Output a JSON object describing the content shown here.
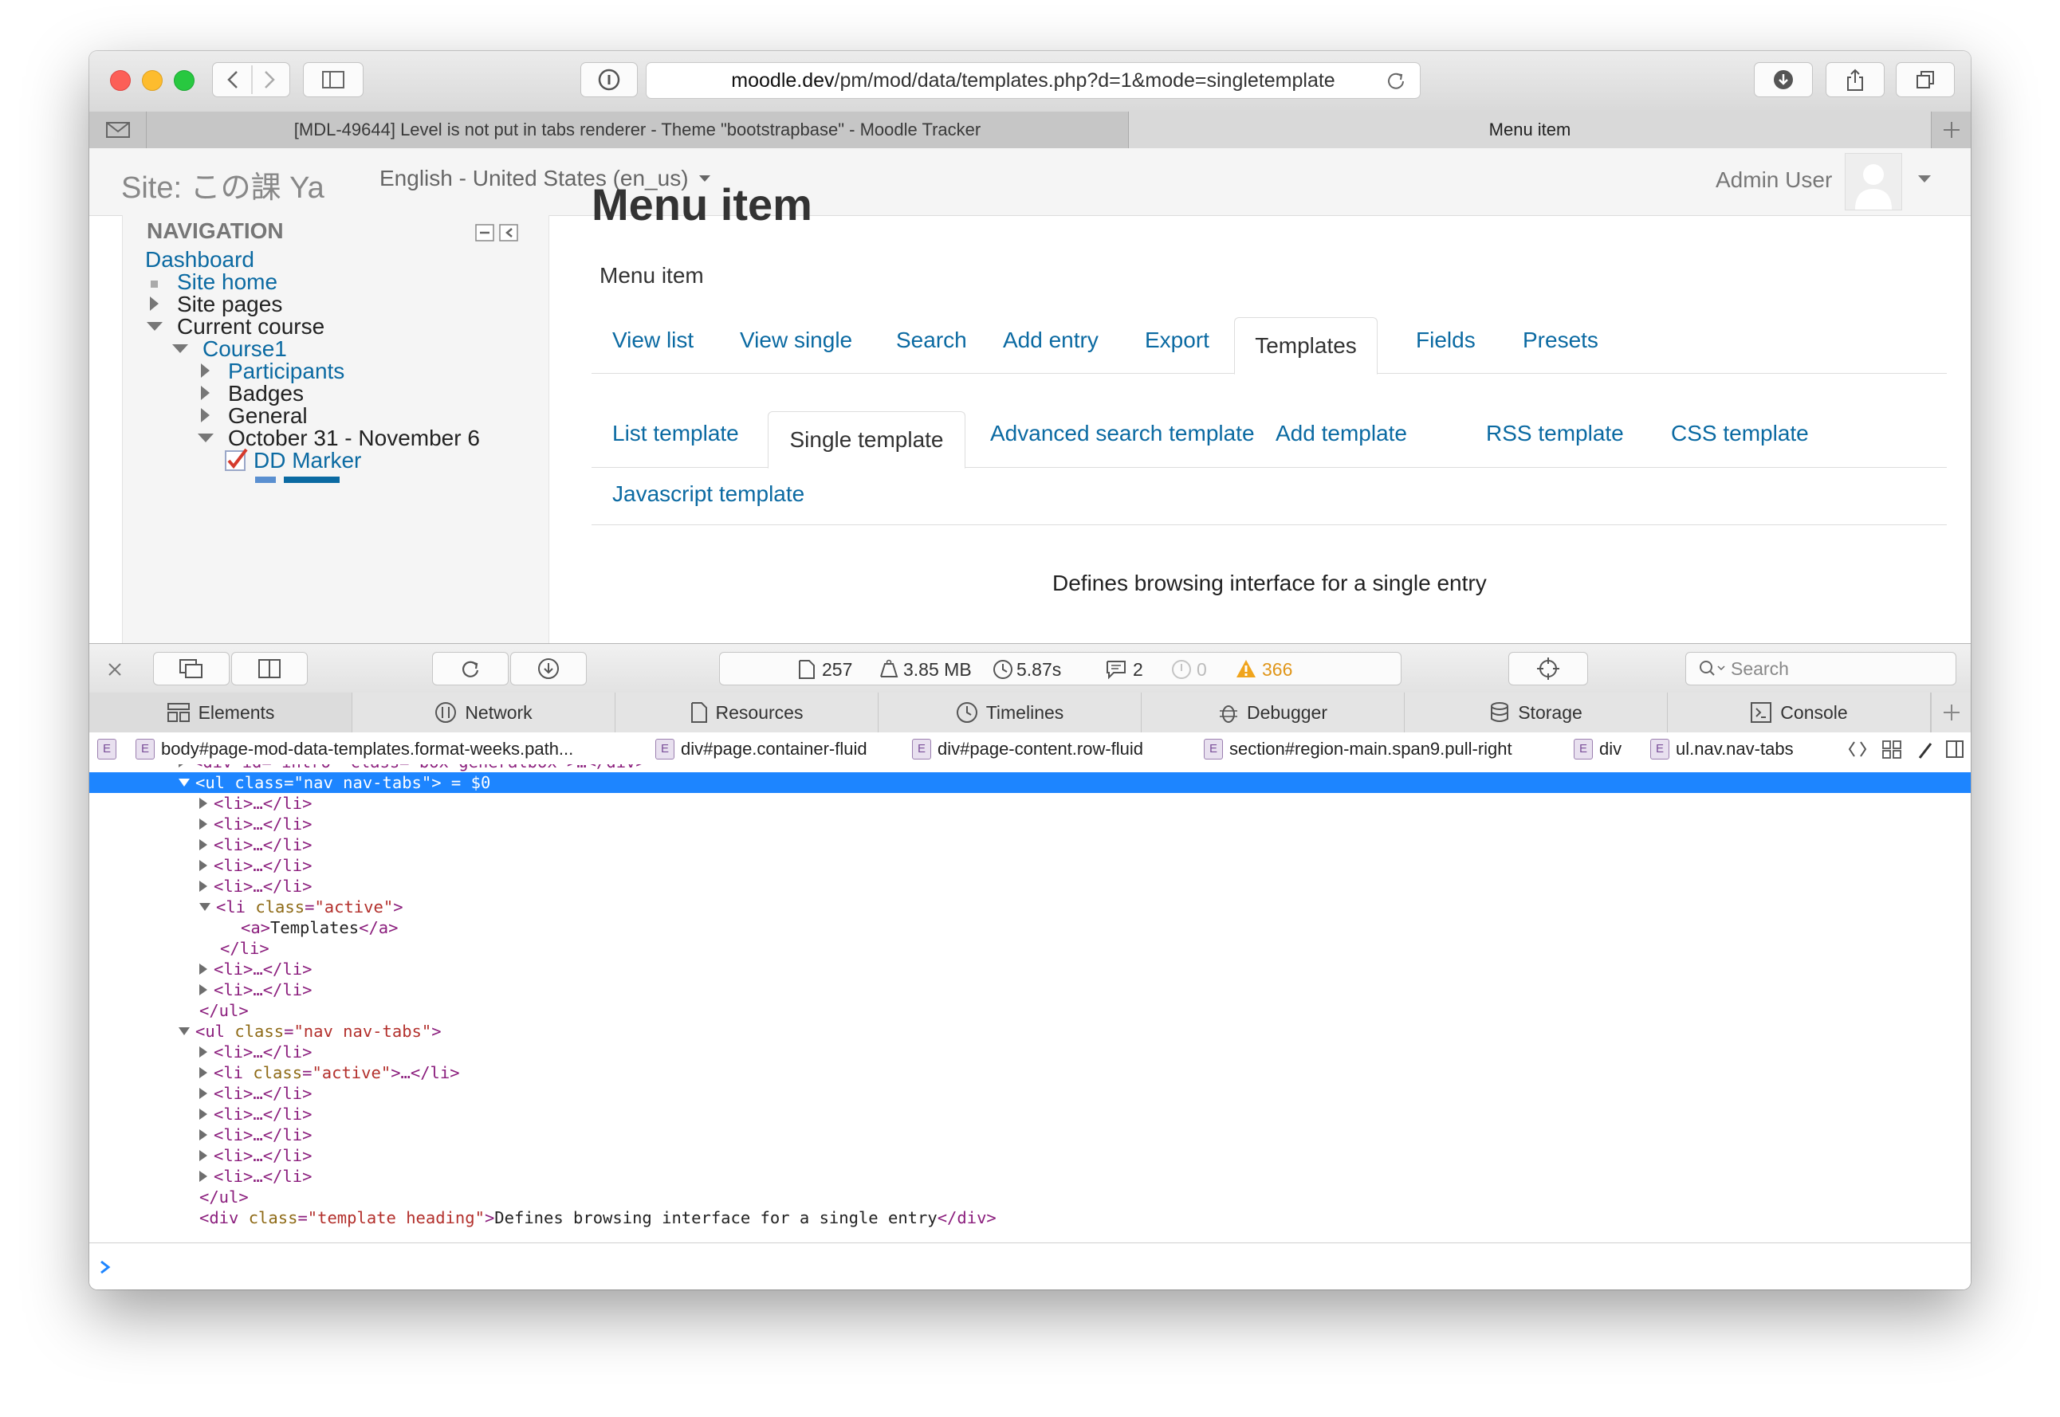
{
  "browser": {
    "url_host": "moodle.dev",
    "url_path": "/pm/mod/data/templates.php?d=1&mode=singletemplate",
    "tabs": [
      {
        "label": "[MDL-49644] Level is not put in tabs renderer - Theme \"bootstrapbase\" - Moodle Tracker"
      },
      {
        "label": "Menu item"
      }
    ]
  },
  "site": {
    "name": "Site: この課 Ya",
    "language": "English - United States (en_us)",
    "user": "Admin User"
  },
  "navigation": {
    "title": "NAVIGATION",
    "items": [
      {
        "label": "Dashboard"
      },
      {
        "label": "Site home"
      },
      {
        "label": "Site pages"
      },
      {
        "label": "Current course"
      },
      {
        "label": "Course1"
      },
      {
        "label": "Participants"
      },
      {
        "label": "Badges"
      },
      {
        "label": "General"
      },
      {
        "label": "October 31 - November 6"
      },
      {
        "label": "DD Marker"
      }
    ]
  },
  "main": {
    "heading": "Menu item",
    "intro": "Menu item",
    "tabs": [
      "View list",
      "View single",
      "Search",
      "Add entry",
      "Export",
      "Templates",
      "Fields",
      "Presets"
    ],
    "subtabs": [
      "List template",
      "Single template",
      "Advanced search template",
      "Add template",
      "RSS template",
      "CSS template",
      "Javascript template"
    ],
    "template_heading": "Defines browsing interface for a single entry"
  },
  "devtools": {
    "stats": {
      "resources": "257",
      "size": "3.85 MB",
      "time": "5.87s",
      "logs": "2",
      "errors": "0",
      "warnings": "366"
    },
    "search_placeholder": "Search",
    "tabs": [
      "Elements",
      "Network",
      "Resources",
      "Timelines",
      "Debugger",
      "Storage",
      "Console"
    ],
    "breadcrumbs": [
      "body#page-mod-data-templates.format-weeks.path...",
      "div#page.container-fluid",
      "div#page-content.row-fluid",
      "section#region-main.span9.pull-right",
      "div",
      "ul.nav.nav-tabs"
    ],
    "dom": {
      "top_partial": "<div id=\"intro\" class=\"box generalbox\">…</div>",
      "sel_tag": "<ul",
      "sel_attr": "class",
      "sel_val": "\"nav nav-tabs\"",
      "sel_suffix": "> = $0",
      "li_collapsed": "<li>…</li>",
      "li_active_open_tag": "<li",
      "li_active_attr": "class",
      "li_active_val": "\"active\"",
      "a_open": "<a>",
      "a_text": "Templates",
      "a_close": "</a>",
      "li_close": "</li>",
      "ul_close": "</ul>",
      "ul_open_tag": "<ul",
      "ul_attr": "class",
      "ul_val": "\"nav nav-tabs\"",
      "li_active_collapsed_suffix": ">…</li>",
      "bottom_tag": "<div",
      "bottom_attr": "class",
      "bottom_val": "\"template heading\"",
      "bottom_text": "Defines browsing interface for a single entry",
      "bottom_close": "</div>"
    }
  },
  "colors": {
    "link": "#0b6aa2",
    "selection": "#1d85ff",
    "warning": "#e8a51b"
  }
}
